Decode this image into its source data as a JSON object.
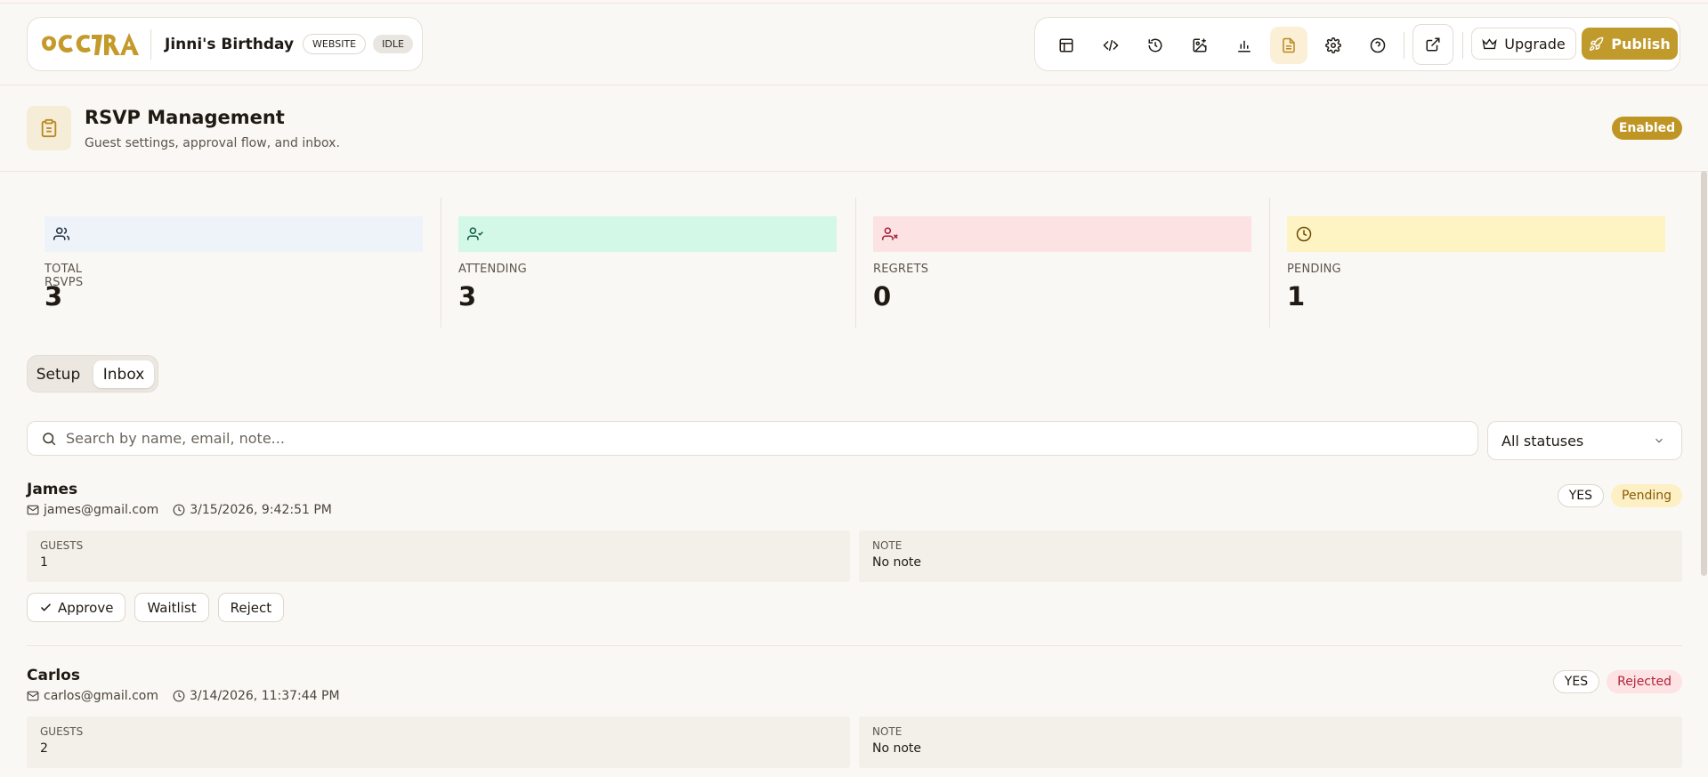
{
  "app": {
    "logo_text": "OCCTRA",
    "site_title": "Jinni's Birthday",
    "type_badge": "WEBSITE",
    "state_badge": "IDLE",
    "accent_color": "#c19a2c"
  },
  "toolbar": {
    "icons": [
      "layout-icon",
      "code-icon",
      "history-icon",
      "image-add-icon",
      "bar-chart-icon",
      "document-icon",
      "gear-icon",
      "help-icon"
    ],
    "active_icon": "document-icon",
    "upgrade_label": "Upgrade",
    "publish_label": "Publish"
  },
  "section": {
    "title": "RSVP Management",
    "subtitle": "Guest settings, approval flow, and inbox.",
    "status": "Enabled"
  },
  "stats": [
    {
      "label": "TOTAL RSVPS",
      "value": "3",
      "icon": "users-icon",
      "color": "#eef3fa"
    },
    {
      "label": "ATTENDING",
      "value": "3",
      "icon": "user-check-icon",
      "color": "#d3f8e7"
    },
    {
      "label": "REGRETS",
      "value": "0",
      "icon": "user-x-icon",
      "color": "#fde2e4"
    },
    {
      "label": "PENDING",
      "value": "1",
      "icon": "clock-icon",
      "color": "#fef3c3"
    }
  ],
  "tabs": {
    "setup": "Setup",
    "inbox": "Inbox",
    "active": "Inbox"
  },
  "search": {
    "placeholder": "Search by name, email, note...",
    "status_filter": "All statuses"
  },
  "rsvps": [
    {
      "name": "James",
      "email": "james@gmail.com",
      "submitted": "3/15/2026, 9:42:51 PM",
      "response": "YES",
      "status": "Pending",
      "guests_label": "GUESTS",
      "guests": "1",
      "note_label": "NOTE",
      "note": "No note",
      "actions": {
        "approve": "Approve",
        "waitlist": "Waitlist",
        "reject": "Reject"
      }
    },
    {
      "name": "Carlos",
      "email": "carlos@gmail.com",
      "submitted": "3/14/2026, 11:37:44 PM",
      "response": "YES",
      "status": "Rejected",
      "guests_label": "GUESTS",
      "guests": "2",
      "note_label": "NOTE",
      "note": "No note"
    }
  ]
}
